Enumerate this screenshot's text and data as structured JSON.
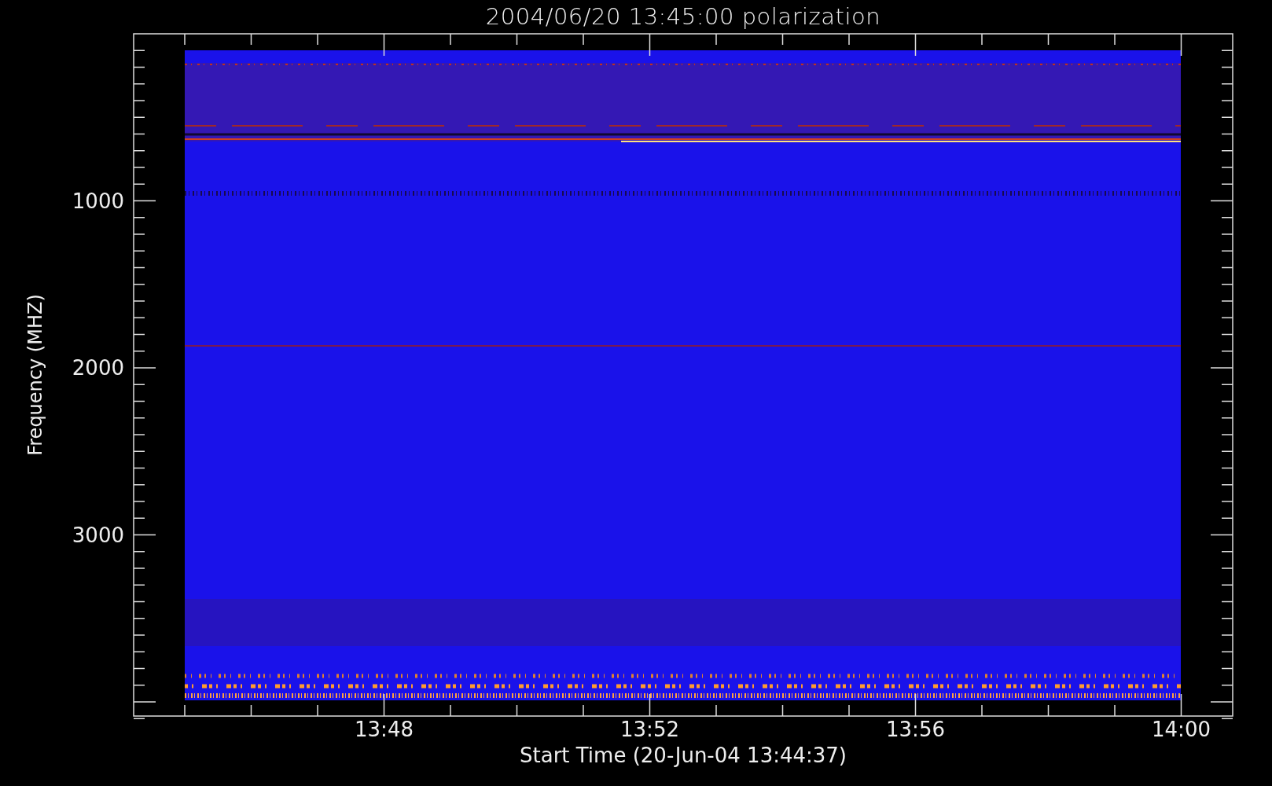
{
  "title": "2004/06/20 13:45:00 polarization",
  "y_axis": {
    "label": "Frequency (MHZ)",
    "ticks": [
      "1000",
      "2000",
      "3000"
    ]
  },
  "x_axis": {
    "label": "Start Time (20-Jun-04 13:44:37)",
    "ticks": [
      "13:48",
      "13:52",
      "13:56",
      "14:00"
    ]
  }
}
